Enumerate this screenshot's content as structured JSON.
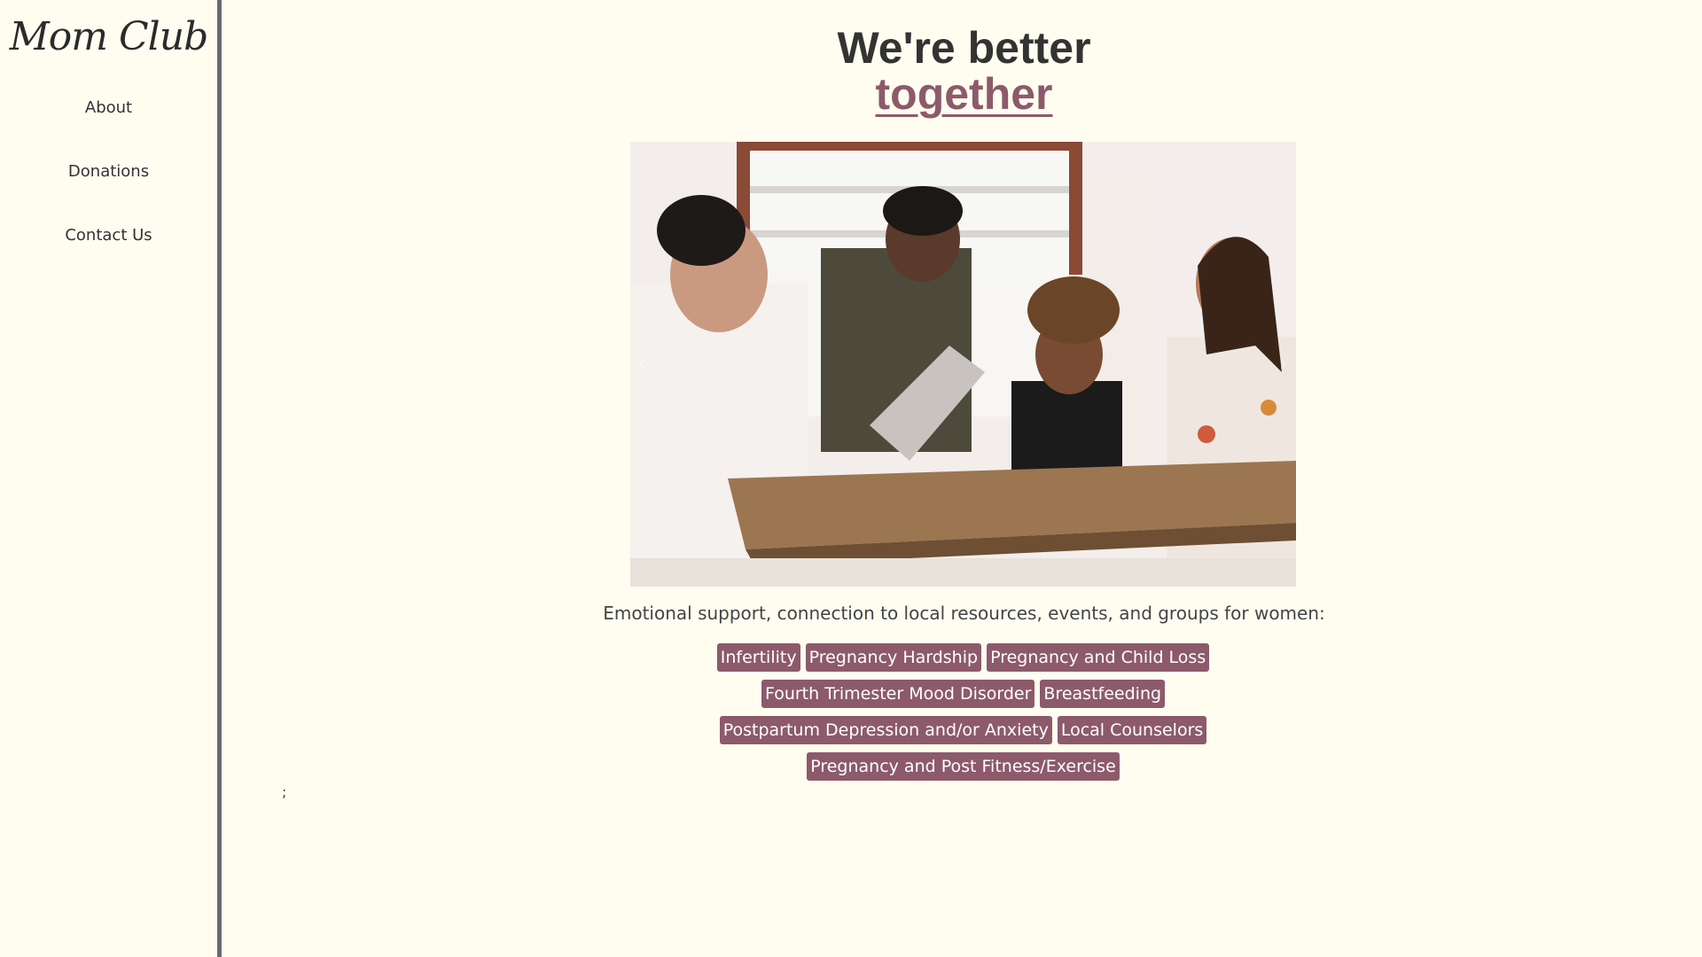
{
  "sidebar": {
    "logo": "Mom Club",
    "nav": [
      "About",
      "Donations",
      "Contact Us"
    ]
  },
  "main": {
    "heading_line1": "We're better",
    "heading_line2": "together",
    "carousel_prev": "‹",
    "carousel_next": "›",
    "subtitle": "Emotional support, connection to local resources, events, and groups for women:",
    "tags": [
      [
        "Infertility",
        "Pregnancy Hardship",
        "Pregnancy and Child Loss"
      ],
      [
        "Fourth Trimester Mood Disorder",
        "Breastfeeding"
      ],
      [
        "Postpartum Depression and/or Anxiety",
        "Local Counselors"
      ],
      [
        "Pregnancy and Post Fitness/Exercise"
      ]
    ],
    "stray_text": ";"
  },
  "colors": {
    "background": "#fffdf0",
    "accent": "#8c5a6b",
    "sidebar_border": "#6b6b6b"
  }
}
